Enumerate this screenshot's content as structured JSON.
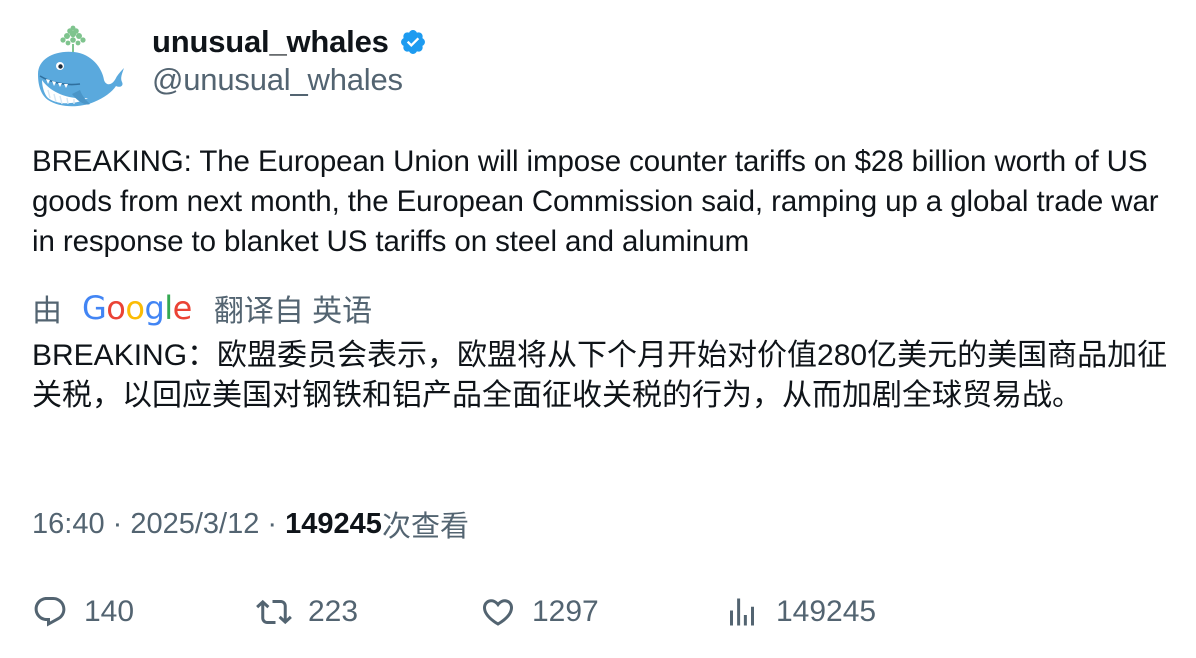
{
  "user": {
    "display_name": "unusual_whales",
    "handle": "@unusual_whales",
    "verified": true,
    "avatar_icon": "whale-avatar-icon",
    "verified_color": "#1d9bf0"
  },
  "tweet": {
    "text": "BREAKING: The European Union will impose counter tariffs on $28 billion worth of US goods from next month, the European Commission said, ramping up a global trade war in response to blanket US tariffs on steel and aluminum"
  },
  "translation": {
    "prefix": "由",
    "provider": "Google",
    "suffix": "翻译自 英语",
    "text": "BREAKING：欧盟委员会表示，欧盟将从下个月开始对价值280亿美元的美国商品加征关税，以回应美国对钢铁和铝产品全面征收关税的行为，从而加剧全球贸易战。"
  },
  "meta": {
    "time": "16:40",
    "separator": " · ",
    "date": "2025/3/12",
    "views_count": "149245",
    "views_label": "次查看"
  },
  "actions": {
    "reply": {
      "icon": "reply-icon",
      "count": "140"
    },
    "retweet": {
      "icon": "retweet-icon",
      "count": "223"
    },
    "like": {
      "icon": "heart-icon",
      "count": "1297"
    },
    "views": {
      "icon": "bar-chart-icon",
      "count": "149245"
    }
  },
  "colors": {
    "text_primary": "#0f1419",
    "text_secondary": "#536471",
    "google_blue": "#4285f4",
    "google_red": "#ea4335",
    "google_yellow": "#fbbc05",
    "google_green": "#34a853"
  }
}
